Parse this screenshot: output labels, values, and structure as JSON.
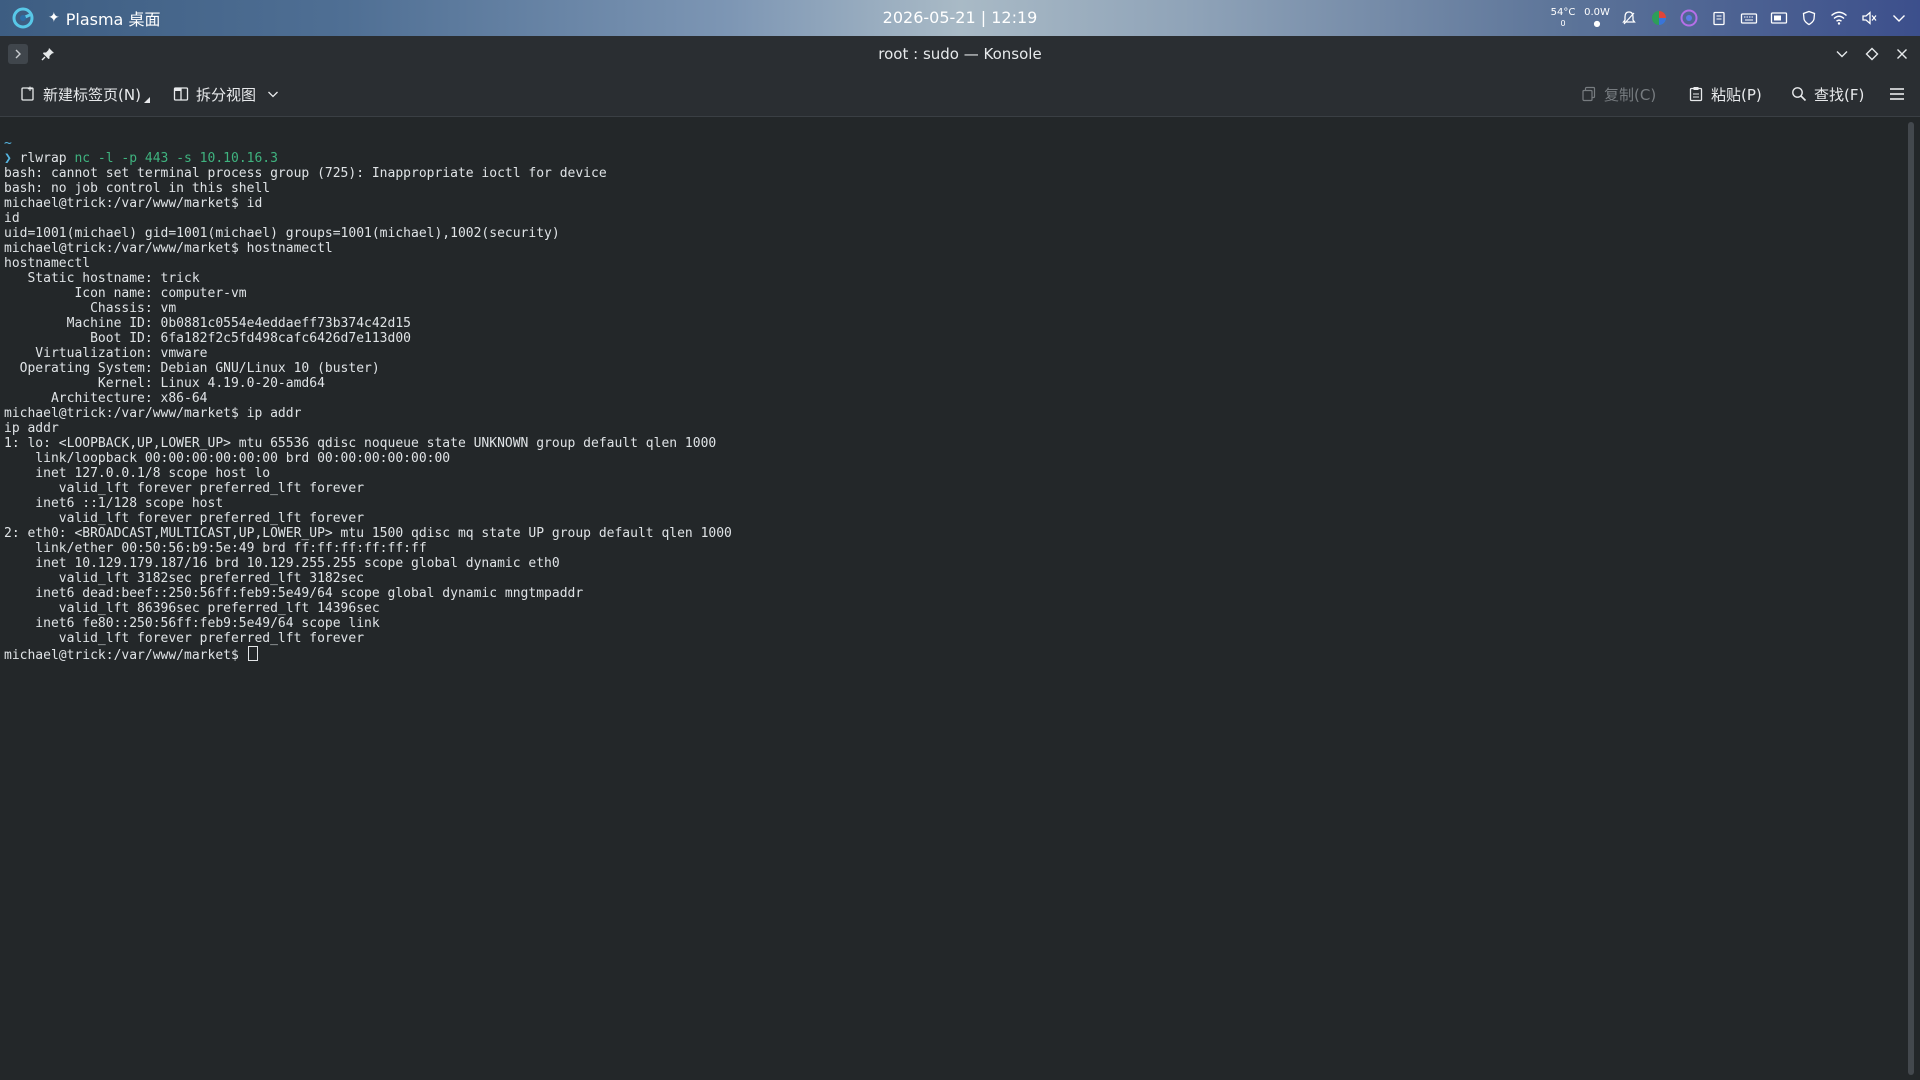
{
  "panel": {
    "app_menu_label": "Plasma 桌面",
    "clock": "2026-05-21 | 12:19",
    "temperature": "54°C",
    "temperature_sub": "0",
    "power": "0.0W",
    "icons": [
      "launcher-icon",
      "notifications-icon",
      "color-picker-icon",
      "activity-icon",
      "clipboard-icon",
      "keyboard-icon",
      "display-icon",
      "vpn-icon",
      "wifi-icon",
      "volume-muted-icon",
      "tray-expand-icon"
    ]
  },
  "window": {
    "title": "root : sudo — Konsole"
  },
  "toolbar": {
    "new_tab": "新建标签页(N)",
    "split_view": "拆分视图",
    "copy": "复制(C)",
    "paste": "粘贴(P)",
    "find": "查找(F)"
  },
  "colors": {
    "background": "#232729",
    "prompt_arrow": "#55b5e0",
    "command_args": "#3fb37f"
  },
  "terminal": {
    "tilde": "~",
    "first_cmd": "rlwrap",
    "first_args": "nc -l -p 443 -s 10.10.16.3",
    "lines": [
      "bash: cannot set terminal process group (725): Inappropriate ioctl for device",
      "bash: no job control in this shell",
      "michael@trick:/var/www/market$ id",
      "id",
      "uid=1001(michael) gid=1001(michael) groups=1001(michael),1002(security)",
      "michael@trick:/var/www/market$ hostnamectl",
      "hostnamectl",
      "   Static hostname: trick",
      "         Icon name: computer-vm",
      "           Chassis: vm",
      "        Machine ID: 0b0881c0554e4eddaeff73b374c42d15",
      "           Boot ID: 6fa182f2c5fd498cafc6426d7e113d00",
      "    Virtualization: vmware",
      "  Operating System: Debian GNU/Linux 10 (buster)",
      "            Kernel: Linux 4.19.0-20-amd64",
      "      Architecture: x86-64",
      "michael@trick:/var/www/market$ ip addr",
      "ip addr",
      "1: lo: <LOOPBACK,UP,LOWER_UP> mtu 65536 qdisc noqueue state UNKNOWN group default qlen 1000",
      "    link/loopback 00:00:00:00:00:00 brd 00:00:00:00:00:00",
      "    inet 127.0.0.1/8 scope host lo",
      "       valid_lft forever preferred_lft forever",
      "    inet6 ::1/128 scope host",
      "       valid_lft forever preferred_lft forever",
      "2: eth0: <BROADCAST,MULTICAST,UP,LOWER_UP> mtu 1500 qdisc mq state UP group default qlen 1000",
      "    link/ether 00:50:56:b9:5e:49 brd ff:ff:ff:ff:ff:ff",
      "    inet 10.129.179.187/16 brd 10.129.255.255 scope global dynamic eth0",
      "       valid_lft 3182sec preferred_lft 3182sec",
      "    inet6 dead:beef::250:56ff:feb9:5e49/64 scope global dynamic mngtmpaddr",
      "       valid_lft 86396sec preferred_lft 14396sec",
      "    inet6 fe80::250:56ff:feb9:5e49/64 scope link",
      "       valid_lft forever preferred_lft forever"
    ],
    "final_prompt": "michael@trick:/var/www/market$ "
  }
}
